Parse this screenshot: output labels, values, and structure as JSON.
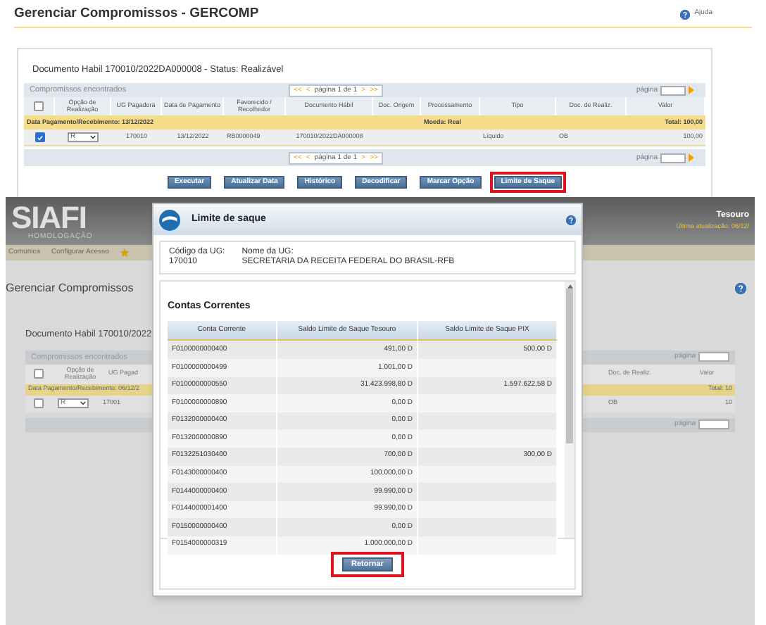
{
  "top": {
    "title": "Gerenciar Compromissos - GERCOMP",
    "help": "Ajuda",
    "document_title": "Documento Habil 170010/2022DA000008 - Status: Realizável",
    "table": {
      "caption": "Compromissos encontrados",
      "pager": {
        "first": "<<",
        "prev": "<",
        "label": "página 1 de 1",
        "next": ">",
        "last": ">>"
      },
      "page_label": "página",
      "columns": [
        "Opção de Realização",
        "UG Pagadora",
        "Data de Pagamento",
        "Favorecido / Recolhedor",
        "Documento Hábil",
        "Doc. Origem",
        "Processamento",
        "Tipo",
        "Doc. de Realiz.",
        "Valor"
      ],
      "group": {
        "label": "Data Pagamento/Recebimento: 13/12/2022",
        "currency": "Moeda: Real",
        "total": "Total: 100,00"
      },
      "all_selected": false,
      "rows": [
        {
          "selected": true,
          "cells": [
            "R",
            "170010",
            "13/12/2022",
            "RB0000049",
            "170010/2022DA000008",
            "",
            "",
            "Líquido",
            "OB",
            "100,00"
          ]
        }
      ],
      "bottom_pager": {
        "first": "<<",
        "prev": "<",
        "label": "página 1 de 1",
        "next": ">",
        "last": ">>"
      },
      "bottom_page_label": "página"
    },
    "buttons": [
      {
        "label": "Executar",
        "highlighted": false
      },
      {
        "label": "Atualizar Data",
        "highlighted": false
      },
      {
        "label": "Histórico",
        "highlighted": false
      },
      {
        "label": "Decodificar",
        "highlighted": false
      },
      {
        "label": "Marcar Opção",
        "highlighted": false
      },
      {
        "label": "Limite de Saque",
        "highlighted": true
      }
    ]
  },
  "bottom": {
    "logo": {
      "name": "SIAFI",
      "environment": "HOMOLOGAÇÃO"
    },
    "brand": "Tesouro",
    "updated": "Última atualização: 06/12/",
    "nav": [
      "Comunica",
      "Configurar Acesso"
    ],
    "title": "Gerenciar Compromissos",
    "document_title": "Documento Habil 170010/2022",
    "caption": "Compromissos encontrados",
    "page_label": "página",
    "columns_left": [
      "Opção de Realização",
      "UG Pagad"
    ],
    "columns_right": [
      "Doc. de Realiz.",
      "Valor"
    ],
    "group_label": "Data Pagamento/Recebimento: 06/12/2",
    "group_total": "Total: 10",
    "all_selected": false,
    "row": {
      "selected": false,
      "option": "R",
      "ug": "17001",
      "doc": "OB",
      "value": "10"
    },
    "bottom_page_label": "página",
    "dialog": {
      "title": "Limite de saque",
      "ug_code_label": "Código da UG:",
      "ug_code": "170010",
      "ug_name_label": "Nome da UG:",
      "ug_name": "SECRETARIA DA RECEITA FEDERAL DO BRASIL-RFB",
      "section": "Contas Correntes",
      "columns": [
        "Conta Corrente",
        "Saldo Limite de Saque Tesouro",
        "Saldo Limite de Saque PIX"
      ],
      "rows": [
        [
          "F0100000000400",
          "491,00 D",
          "500,00 D"
        ],
        [
          "F0100000000499",
          "1.001,00 D",
          ""
        ],
        [
          "F0100000000550",
          "31.423.998,80 D",
          "1.597.622,58 D"
        ],
        [
          "F0100000000890",
          "0,00 D",
          ""
        ],
        [
          "F0132000000400",
          "0,00 D",
          ""
        ],
        [
          "F0132000000890",
          "0,00 D",
          ""
        ],
        [
          "F0132251030400",
          "700,00 D",
          "300,00 D"
        ],
        [
          "F0143000000400",
          "100.000,00 D",
          ""
        ],
        [
          "F0144000000400",
          "99.990,00 D",
          ""
        ],
        [
          "F0144000001400",
          "99.990,00 D",
          ""
        ],
        [
          "F0150000000400",
          "0,00 D",
          ""
        ],
        [
          "F0154000000319",
          "1.000.000,00 D",
          ""
        ]
      ],
      "button": {
        "label": "Retornar",
        "highlighted": true
      }
    }
  }
}
